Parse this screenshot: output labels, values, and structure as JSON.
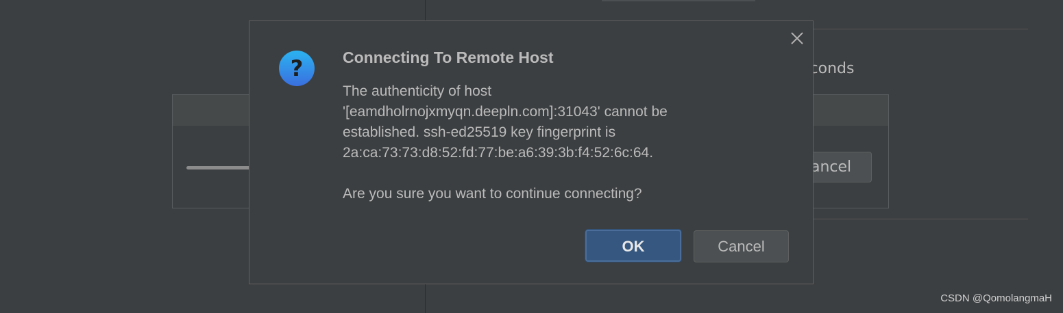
{
  "background": {
    "seconds_text": "econds",
    "cancel_text": "ancel"
  },
  "dialog": {
    "icon": "question-icon",
    "title": "Connecting To Remote Host",
    "message_lines": [
      "The authenticity of host",
      "'[eamdholrnojxmyqn.deepln.com]:31043' cannot be",
      "established. ssh-ed25519 key fingerprint is",
      "2a:ca:73:73:d8:52:fd:77:be:a6:39:3b:f4:52:6c:64."
    ],
    "question": "Are you sure you want to continue connecting?",
    "ok_label": "OK",
    "cancel_label": "Cancel",
    "close_icon": "close-icon"
  },
  "watermark": "CSDN @QomolangmaH",
  "colors": {
    "accent": "#365880",
    "icon_blue": "#2f8ee8"
  }
}
